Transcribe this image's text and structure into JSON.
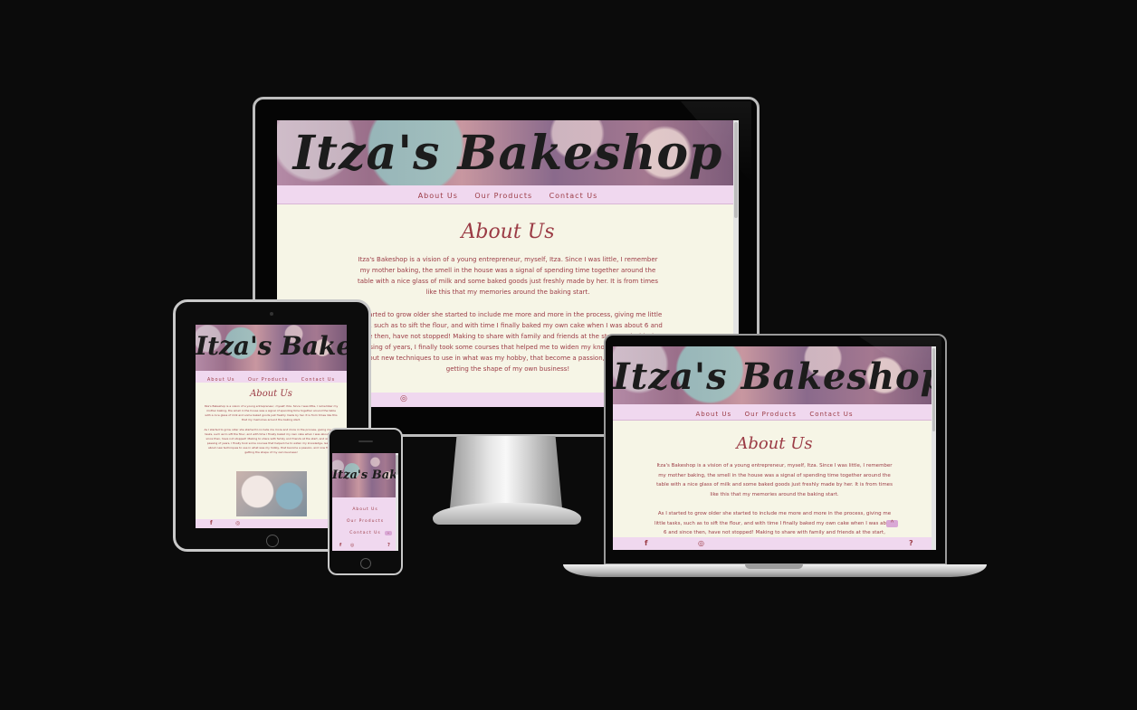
{
  "site": {
    "title": "Itza's Bakeshop",
    "nav": [
      "About Us",
      "Our Products",
      "Contact Us"
    ],
    "heading": "About Us",
    "para1": "Itza's Bakeshop is a vision of a young entrepreneur, myself, Itza. Since I was little, I remember my mother baking, the smell in the house was a signal of spending time together around the table with a nice glass of milk and some baked goods just freshly made by her. It is from times like this that my memories around the baking start.",
    "para2": "As I started to grow older she started to include me more and more in the process, giving me little tasks, such as to sift the flour, and with time I finally baked my own cake when I was about 6 and since then, have not stopped! Making to share with family and friends at the start, and with the passing of years, I finally took some courses that helped me to widen my knowledge, learning about new techniques to use in what was my hobby, that become a passion, and now finally getting the shape of my own business!",
    "monitor_para2_visible": "s I started to grow older she started to include me more and more in the process, giving me little tasks, such as to sift the flour, and with time I finally baked my own cake when I was about 6 and since then, have not stopped! Making to share with family and friends at the start, and with the passing of years, I finally took some courses that helped me to widen my knowledge, learning about new techniques to use in what was my hobby, that become a passion, and now finally getting the shape of my own business!",
    "laptop_para2_visible": "As I started to grow older she started to include me more and more in the process, giving me little tasks, such as to sift the flour, and with time I finally baked my own cake when I was about 6 and since then, have not stopped! Making to share with family and friends at the start,"
  },
  "icons": {
    "facebook": "f",
    "instagram": "◎",
    "question": "?",
    "up": "^"
  },
  "colors": {
    "accent": "#9b3b45",
    "nav_bg": "#f0d8ef",
    "content_bg": "#f6f5e6",
    "backdrop": "#0b0b0b"
  }
}
